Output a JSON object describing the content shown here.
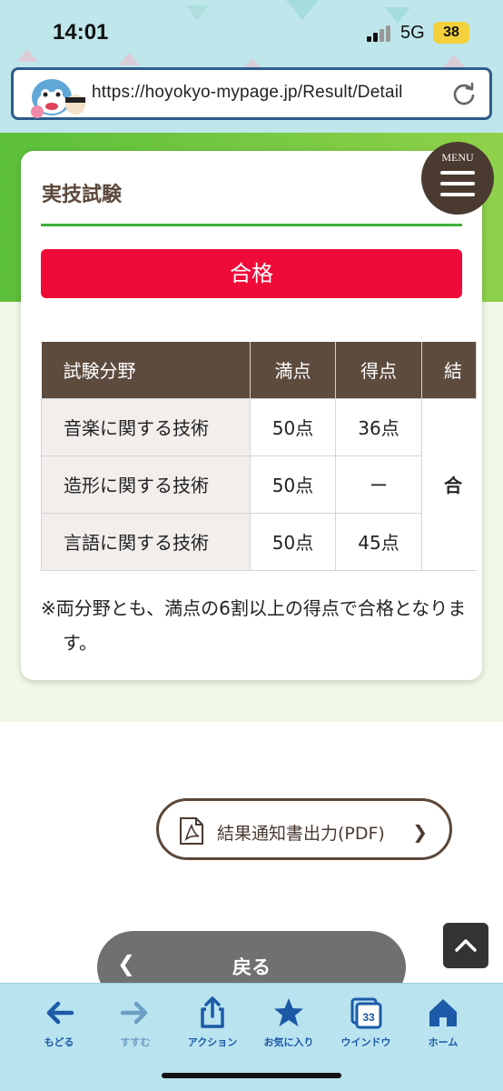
{
  "status_bar": {
    "time": "14:01",
    "network": "5G",
    "battery": "38"
  },
  "browser": {
    "url": "https://hoyokyo-mypage.jp/Result/Detail"
  },
  "menu": {
    "label": "MENU"
  },
  "card": {
    "title": "実技試験",
    "status": "合格",
    "table": {
      "headers": [
        "試験分野",
        "満点",
        "得点",
        "結"
      ],
      "rows": [
        {
          "field": "音楽に関する技術",
          "full": "50点",
          "score": "36点"
        },
        {
          "field": "造形に関する技術",
          "full": "50点",
          "score": "ー"
        },
        {
          "field": "言語に関する技術",
          "full": "50点",
          "score": "45点"
        }
      ],
      "result": "合"
    },
    "note": "※両分野とも、満点の6割以上の得点で合格となります。"
  },
  "pdf_button": {
    "label": "結果通知書出力(PDF)"
  },
  "back_button": {
    "label": "戻る"
  },
  "bottom_nav": {
    "items": [
      {
        "label": "もどる"
      },
      {
        "label": "すすむ"
      },
      {
        "label": "アクション"
      },
      {
        "label": "お気に入り"
      },
      {
        "label": "ウインドウ",
        "badge": "33"
      },
      {
        "label": "ホーム"
      }
    ]
  },
  "colors": {
    "accent_green": "#3fae3a",
    "pass_red": "#ef0a3a",
    "brown": "#5d4b3e",
    "nav_blue": "#1c5aa8"
  }
}
